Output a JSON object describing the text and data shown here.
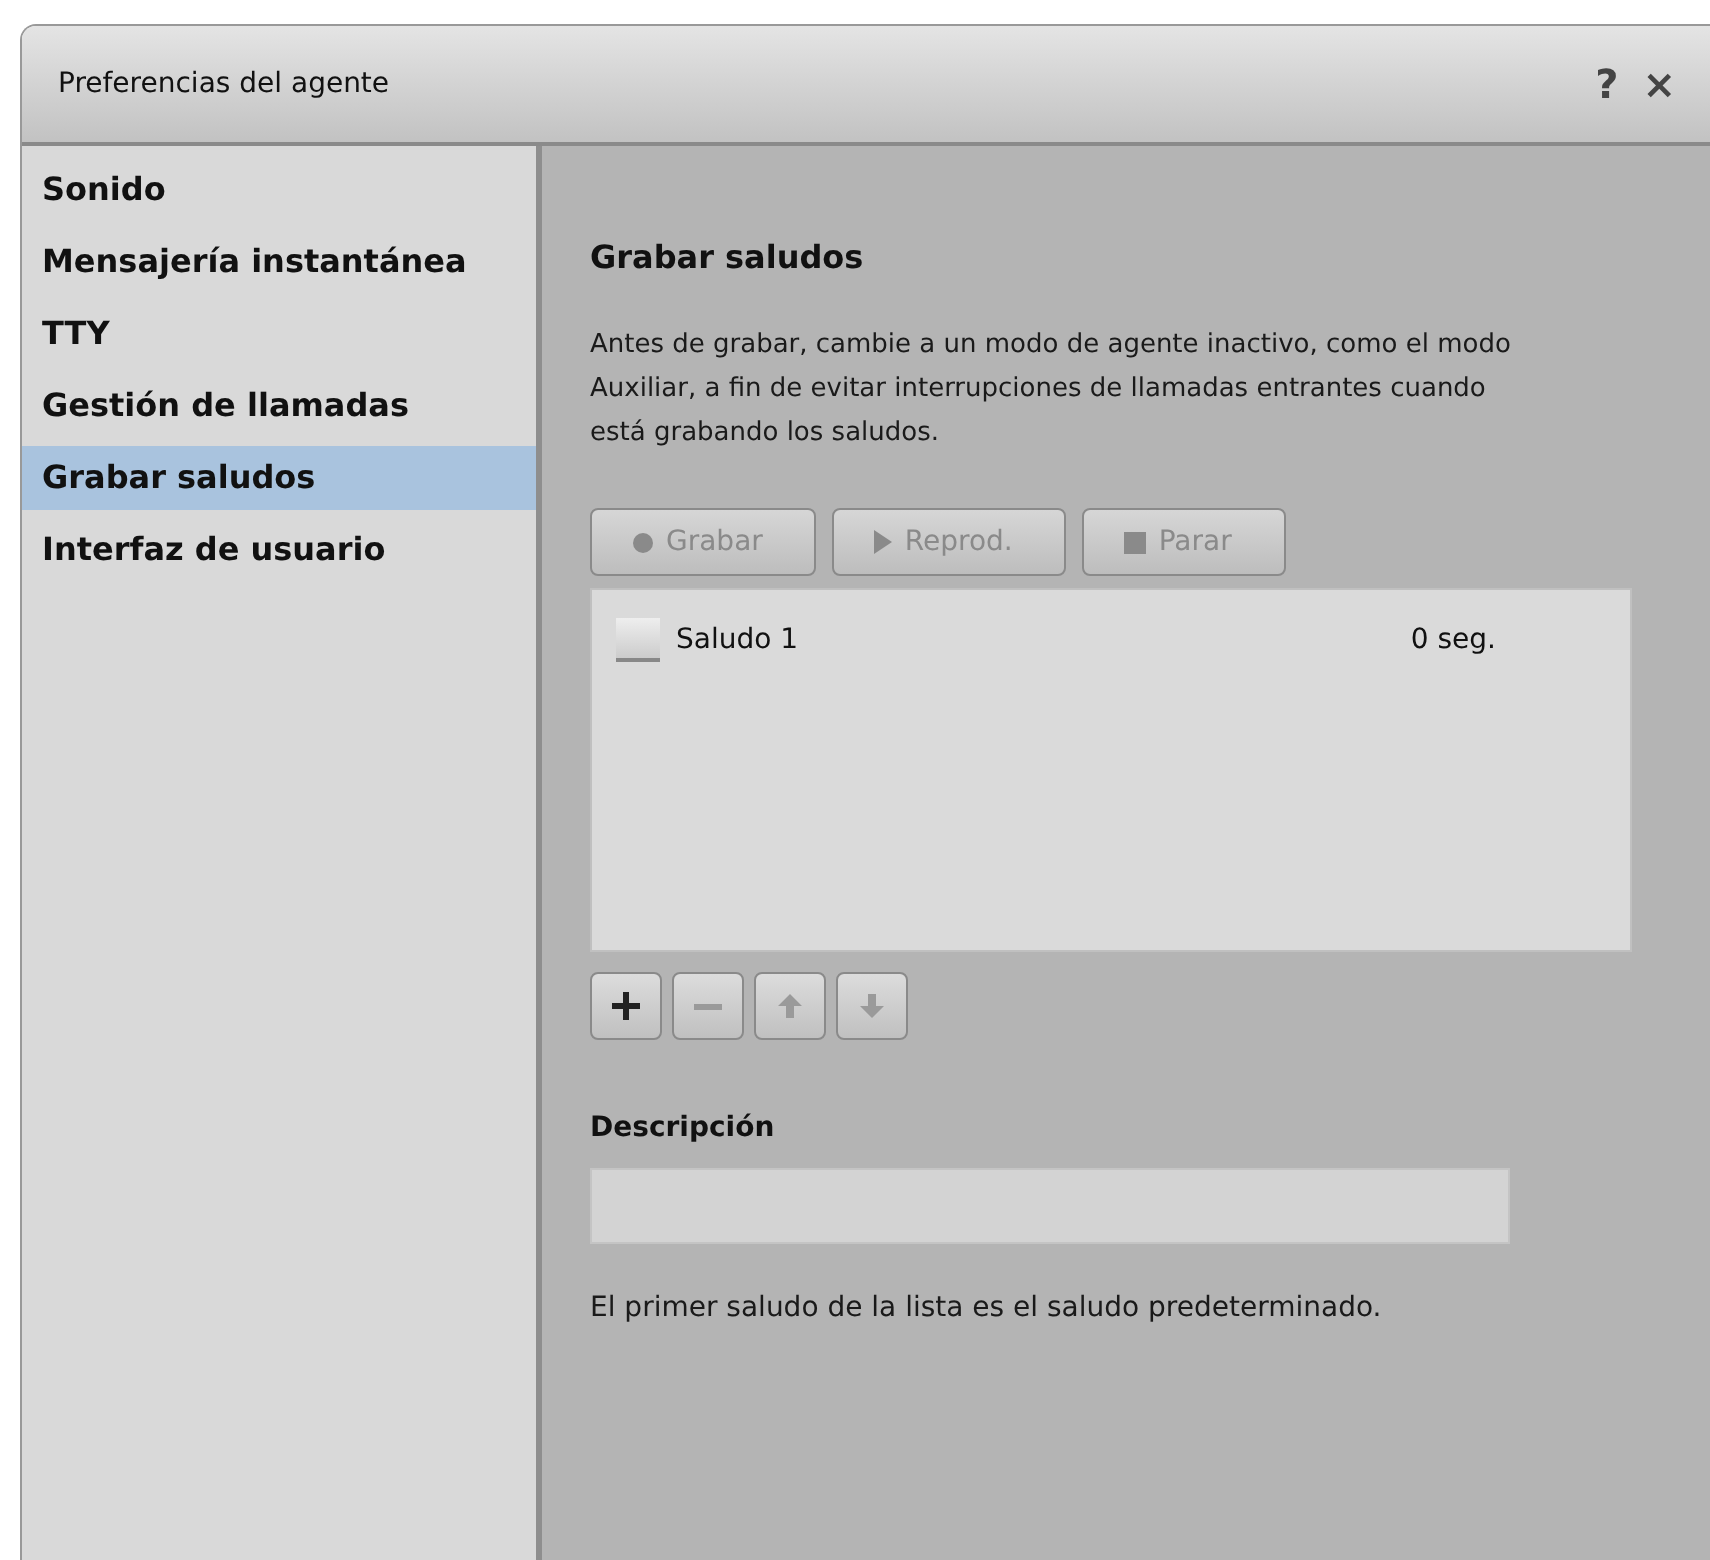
{
  "window": {
    "title": "Preferencias del agente",
    "help": "?",
    "close": "×"
  },
  "sidebar": {
    "items": [
      {
        "label": "Sonido",
        "selected": false
      },
      {
        "label": "Mensajería instantánea",
        "selected": false
      },
      {
        "label": "TTY",
        "selected": false
      },
      {
        "label": "Gestión de llamadas",
        "selected": false
      },
      {
        "label": "Grabar saludos",
        "selected": true
      },
      {
        "label": "Interfaz de usuario",
        "selected": false
      }
    ]
  },
  "content": {
    "heading": "Grabar saludos",
    "intro": "Antes de grabar, cambie a un modo de agente inactivo, como el modo Auxiliar, a fin de evitar interrupciones de llamadas entrantes cuando está grabando los saludos.",
    "buttons": [
      {
        "kind": "record",
        "label": "Grabar",
        "disabled": true
      },
      {
        "kind": "play",
        "label": "Reprod.",
        "disabled": true
      },
      {
        "kind": "stop",
        "label": "Parar",
        "disabled": true
      }
    ],
    "greetings": [
      {
        "name": "Saludo 1",
        "duration": "0 seg.",
        "checked": false
      }
    ],
    "list_tools": [
      {
        "kind": "add",
        "disabled": false
      },
      {
        "kind": "remove",
        "disabled": true
      },
      {
        "kind": "up",
        "disabled": true
      },
      {
        "kind": "down",
        "disabled": true
      }
    ],
    "description_label": "Descripción",
    "footer": "El primer saludo de la lista es el saludo predeterminado."
  }
}
